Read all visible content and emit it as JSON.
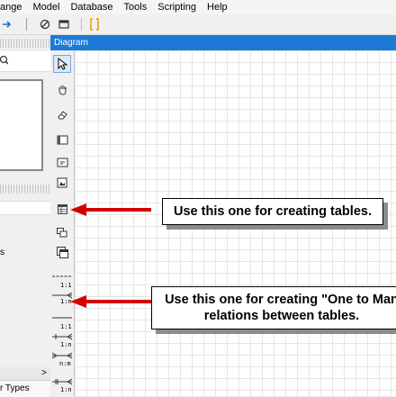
{
  "menubar": {
    "items": [
      "ange",
      "Model",
      "Database",
      "Tools",
      "Scripting",
      "Help"
    ]
  },
  "toolbar": {
    "icons": [
      "arrow-icon",
      "no-icon",
      "window-icon",
      "bracket-icon"
    ]
  },
  "diagram": {
    "tab_title": "Diagram"
  },
  "left_panel": {
    "partial_text": "s",
    "bottom_tab": "r Types",
    "scroll_arrow": ">"
  },
  "palette": {
    "tools": [
      {
        "icon": "pointer-icon",
        "selected": true
      },
      {
        "icon": "hand-icon"
      },
      {
        "icon": "eraser-icon"
      },
      {
        "icon": "frame-icon"
      },
      {
        "icon": "note-icon"
      },
      {
        "icon": "image-icon"
      },
      {
        "icon": "table-icon"
      },
      {
        "icon": "view-icon"
      },
      {
        "icon": "copy-icon"
      }
    ],
    "relations": [
      {
        "label": "1:1"
      },
      {
        "label": "1:n"
      },
      {
        "label": "1:1"
      },
      {
        "label": "1:n"
      },
      {
        "label": "n:m"
      },
      {
        "label": "1:n"
      }
    ]
  },
  "callouts": {
    "tables": "Use this one for creating tables.",
    "relations_line1": "Use this one for creating \"One to Man",
    "relations_line2": "relations between tables."
  },
  "colors": {
    "header_blue": "#1e7ad6",
    "arrow_red": "#d40000"
  }
}
